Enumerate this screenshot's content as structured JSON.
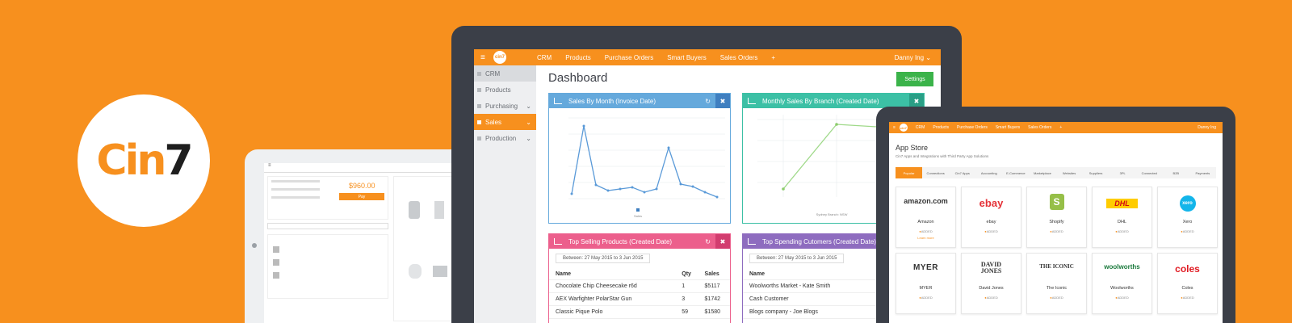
{
  "logo": {
    "text_c": "Cin",
    "text_n": "7"
  },
  "laptop": {
    "nav": {
      "brand": "cin7",
      "items": [
        "CRM",
        "Products",
        "Purchase Orders",
        "Smart Buyers",
        "Sales Orders",
        "+"
      ],
      "user": "Danny Ing ⌄"
    },
    "sidebar": [
      {
        "label": "CRM"
      },
      {
        "label": "Products"
      },
      {
        "label": "Purchasing"
      },
      {
        "label": "Sales"
      },
      {
        "label": "Production"
      }
    ],
    "title": "Dashboard",
    "settings_label": "Settings",
    "panels": {
      "sales_by_month": {
        "title": "Sales By Month (Invoice Date)",
        "color": "#65a9dc",
        "legend": "Sales"
      },
      "monthly_by_branch": {
        "title": "Monthly Sales By Branch (Created Date)",
        "color": "#3cc0a5",
        "legend": "Sydney Branch: NSW"
      },
      "top_products": {
        "title": "Top Selling Products (Created Date)",
        "color": "#ec5f8c",
        "filter": "Between: 27 May 2015 to 3 Jun 2015",
        "headers": [
          "Name",
          "Qty",
          "Sales"
        ],
        "rows": [
          [
            "Chocolate Chip Cheesecake r6d",
            "1",
            "$5117"
          ],
          [
            "AEX Warfighter PolarStar Gun",
            "3",
            "$1742"
          ],
          [
            "Classic Pique Polo",
            "59",
            "$1580"
          ]
        ]
      },
      "top_customers": {
        "title": "Top Spending Cutomers (Created Date)",
        "color": "#8e6cbf",
        "filter": "Between: 27 May 2015 to 3 Jun 2015",
        "headers": [
          "Name"
        ],
        "rows": [
          [
            "Woolworths Market - Kate Smith"
          ],
          [
            "Cash Customer"
          ],
          [
            "Blogs company - Joe Blogs"
          ]
        ]
      }
    }
  },
  "tablet_left": {
    "total": "$960.00",
    "pay": "Pay"
  },
  "tablet_right": {
    "nav": {
      "brand": "cin7",
      "items": [
        "CRM",
        "Products",
        "Purchase Orders",
        "Smart Buyers",
        "Sales Orders",
        "+"
      ],
      "user": "Danny Ing"
    },
    "title": "App Store",
    "subtitle": "Cin7 Apps and Integrations with Third Party App Solutions",
    "categories": [
      "Popular",
      "Connections",
      "Cin7 Apps",
      "Accounting",
      "E-Commerce",
      "Marketplace",
      "Websites",
      "Suppliers",
      "3PL",
      "Connected",
      "B2B",
      "Payments"
    ],
    "apps": [
      {
        "logo": "amazon.com",
        "name": "Amazon",
        "add": "ADDED",
        "more": "Learn more",
        "color": "#111111"
      },
      {
        "logo": "ebay",
        "name": "ebay",
        "add": "ADDED",
        "color": "#e53238"
      },
      {
        "logo": "S",
        "name": "Shopify",
        "add": "ADDED",
        "color": "#96bf48"
      },
      {
        "logo": "DHL",
        "name": "DHL",
        "add": "ADDED",
        "color": "#d40511"
      },
      {
        "logo": "xero",
        "name": "Xero",
        "add": "ADDED",
        "color": "#13b5ea"
      },
      {
        "logo": "MYER",
        "name": "MYER",
        "add": "ADDED",
        "color": "#111111"
      },
      {
        "logo": "DAVID JONES",
        "name": "David Jones",
        "add": "ADDED",
        "color": "#111111"
      },
      {
        "logo": "THE ICONIC",
        "name": "The Iconic",
        "add": "ADDED",
        "color": "#111111"
      },
      {
        "logo": "woolworths",
        "name": "Woolworths",
        "add": "ADDED",
        "color": "#1a7a3c"
      },
      {
        "logo": "coles",
        "name": "Coles",
        "add": "ADDED",
        "color": "#e01a22"
      }
    ]
  }
}
